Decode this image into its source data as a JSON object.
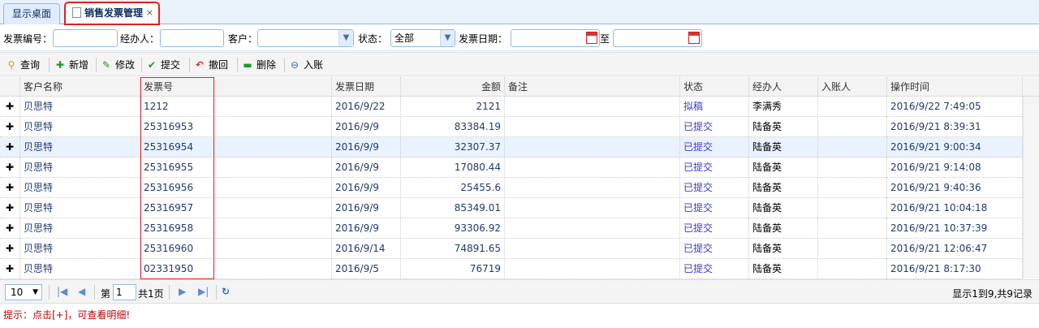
{
  "tabs": [
    {
      "label": "显示桌面"
    },
    {
      "label": "销售发票管理",
      "close": "×"
    }
  ],
  "filters": {
    "invoice_no_label": "发票编号：",
    "handler_label": "经办人：",
    "customer_label": "客户：",
    "status_label": "状态：",
    "status_value": "全部",
    "date_label": "发票日期：",
    "to_label": "至"
  },
  "toolbar": {
    "query": "查询",
    "add": "新增",
    "edit": "修改",
    "submit": "提交",
    "revoke": "撤回",
    "delete": "删除",
    "post": "入账"
  },
  "grid": {
    "headers": [
      "客户名称",
      "发票号",
      "发票日期",
      "金额",
      "备注",
      "状态",
      "经办人",
      "入账人",
      "操作时间"
    ],
    "expand_glyph": "✚",
    "rows": [
      {
        "customer": "贝思特",
        "invoice": "1212",
        "date": "2016/9/22",
        "amount": "2121",
        "note": "",
        "status": "拟稿",
        "handler": "李满秀",
        "poster": "",
        "time": "2016/9/22 7:49:05"
      },
      {
        "customer": "贝思特",
        "invoice": "25316953",
        "date": "2016/9/9",
        "amount": "83384.19",
        "note": "",
        "status": "已提交",
        "handler": "陆备英",
        "poster": "",
        "time": "2016/9/21 8:39:31"
      },
      {
        "customer": "贝思特",
        "invoice": "25316954",
        "date": "2016/9/9",
        "amount": "32307.37",
        "note": "",
        "status": "已提交",
        "handler": "陆备英",
        "poster": "",
        "time": "2016/9/21 9:00:34"
      },
      {
        "customer": "贝思特",
        "invoice": "25316955",
        "date": "2016/9/9",
        "amount": "17080.44",
        "note": "",
        "status": "已提交",
        "handler": "陆备英",
        "poster": "",
        "time": "2016/9/21 9:14:08"
      },
      {
        "customer": "贝思特",
        "invoice": "25316956",
        "date": "2016/9/9",
        "amount": "25455.6",
        "note": "",
        "status": "已提交",
        "handler": "陆备英",
        "poster": "",
        "time": "2016/9/21 9:40:36"
      },
      {
        "customer": "贝思特",
        "invoice": "25316957",
        "date": "2016/9/9",
        "amount": "85349.01",
        "note": "",
        "status": "已提交",
        "handler": "陆备英",
        "poster": "",
        "time": "2016/9/21 10:04:18"
      },
      {
        "customer": "贝思特",
        "invoice": "25316958",
        "date": "2016/9/9",
        "amount": "93306.92",
        "note": "",
        "status": "已提交",
        "handler": "陆备英",
        "poster": "",
        "time": "2016/9/21 10:37:39"
      },
      {
        "customer": "贝思特",
        "invoice": "25316960",
        "date": "2016/9/14",
        "amount": "74891.65",
        "note": "",
        "status": "已提交",
        "handler": "陆备英",
        "poster": "",
        "time": "2016/9/21 12:06:47"
      },
      {
        "customer": "贝思特",
        "invoice": "02331950",
        "date": "2016/9/5",
        "amount": "76719",
        "note": "",
        "status": "已提交",
        "handler": "陆备英",
        "poster": "",
        "time": "2016/9/21 8:17:30"
      }
    ]
  },
  "pager": {
    "page_size": "10",
    "page_prefix": "第",
    "page_value": "1",
    "page_total": "共1页",
    "info": "显示1到9,共9记录"
  },
  "hint": "提示：点击[+]，可查看明细!"
}
